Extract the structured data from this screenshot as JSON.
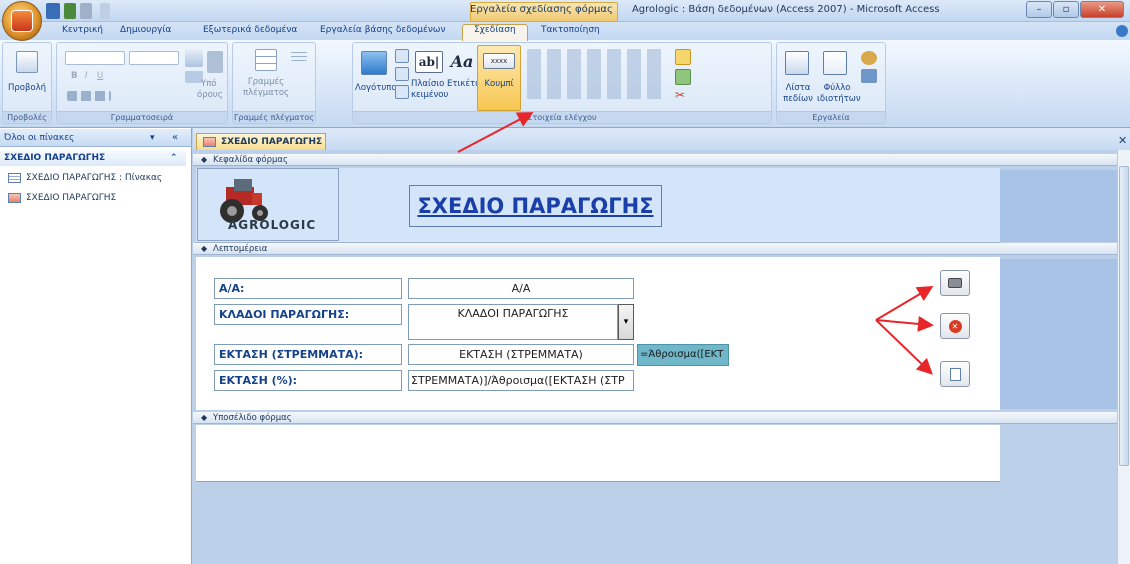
{
  "window": {
    "context_title": "Εργαλεία σχεδίασης φόρμας",
    "title": "Agrologic : Βάση δεδομένων (Access 2007) - Microsoft Access"
  },
  "ribbon_tabs": [
    "Κεντρική",
    "Δημιουργία",
    "Εξωτερικά δεδομένα",
    "Εργαλεία βάσης δεδομένων",
    "Σχεδίαση",
    "Τακτοποίηση"
  ],
  "ribbon": {
    "groups": {
      "views": "Προβολές",
      "font": "Γραμματοσειρά",
      "gridlines": "Γραμμές πλέγματος",
      "controls": "Στοιχεία ελέγχου",
      "tools": "Εργαλεία"
    },
    "view_btn": "Προβολή",
    "under_line_1": "Υπό",
    "under_line_2": "όρους",
    "gridlines_btn_1": "Γραμμές",
    "gridlines_btn_2": "πλέγματος",
    "logo_btn": "Λογότυπο",
    "textbox_btn_1": "Πλαίσιο",
    "textbox_btn_2": "κειμένου",
    "label_btn": "Ετικέτα",
    "button_btn": "Κουμπί",
    "fieldlist_btn_1": "Λίστα",
    "fieldlist_btn_2": "πεδίων",
    "propsheet_btn_1": "Φύλλο",
    "propsheet_btn_2": "ιδιοτήτων",
    "textbox_icon_text": "ab|",
    "label_icon_text": "Aa",
    "button_icon_text": "xxxx"
  },
  "nav": {
    "header": "Όλοι οι πίνακες",
    "group": "ΣΧΕΔΙΟ ΠΑΡΑΓΩΓΗΣ",
    "items": [
      {
        "label": "ΣΧΕΔΙΟ ΠΑΡΑΓΩΓΗΣ : Πίνακας",
        "icon": "table-icon"
      },
      {
        "label": "ΣΧΕΔΙΟ ΠΑΡΑΓΩΓΗΣ",
        "icon": "form-icon"
      }
    ]
  },
  "document": {
    "tab_label": "ΣΧΕΔΙΟ ΠΑΡΑΓΩΓΗΣ",
    "sections": {
      "header": "Κεφαλίδα φόρμας",
      "detail": "Λεπτομέρεια",
      "footer": "Υποσέλιδο φόρμας"
    },
    "logo_text": "AGROLOGIC",
    "form_title": "ΣΧΕΔΙΟ ΠΑΡΑΓΩΓΗΣ",
    "fields": [
      {
        "label": "Α/Α:",
        "value": "Α/Α"
      },
      {
        "label": "ΚΛΑΔΟΙ ΠΑΡΑΓΩΓΗΣ:",
        "value": "ΚΛΑΔΟΙ ΠΑΡΑΓΩΓΗΣ"
      },
      {
        "label": "ΕΚΤΑΣΗ (ΣΤΡΕΜΜΑΤΑ):",
        "value": "ΕΚΤΑΣΗ (ΣΤΡΕΜΜΑΤΑ)"
      },
      {
        "label": "ΕΚΤΑΣΗ  (%):",
        "value": "ΣΤΡΕΜΜΑΤΑ)]/Άθροισμα([ΕΚΤΑΣΗ (ΣΤΡ"
      }
    ],
    "sum_box": "=Άθροισμα([ΕΚΤ"
  },
  "colors": {
    "accent_red": "#e8262a",
    "sum_box_bg": "#6fb7c9",
    "form_header_bg": "#d5e5f9"
  }
}
